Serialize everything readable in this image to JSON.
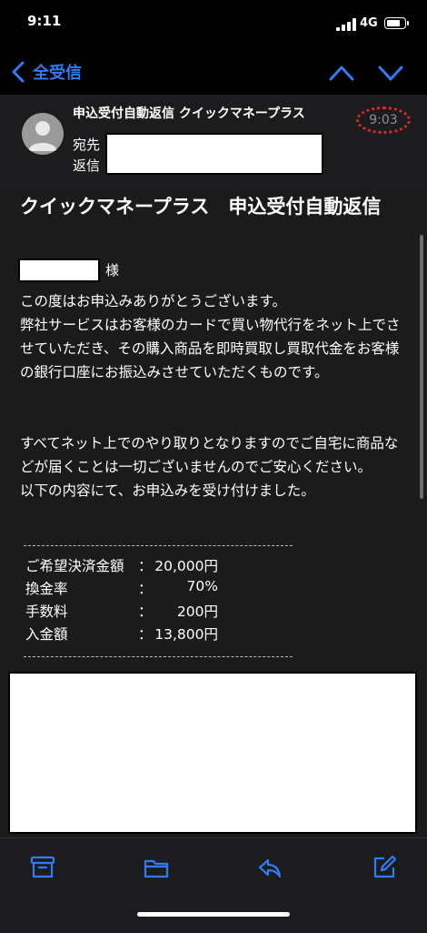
{
  "status_bar": {
    "time": "9:11",
    "network": "4G"
  },
  "nav": {
    "back_label": "全受信"
  },
  "header": {
    "sender": "申込受付自動返信 クイックマネープラス",
    "time": "9:03",
    "to_label": "宛先",
    "reply_label": "返信"
  },
  "message": {
    "title": "クイックマネープラス　申込受付自動返信",
    "honorific": "様",
    "paragraph1": "この度はお申込みありがとうございます。\n弊社サービスはお客様のカードで買い物代行をネット上でさせていただき、その購入商品を即時買取し買取代金をお客様の銀行口座にお振込みさせていただくものです。",
    "paragraph2": "すべてネット上でのやり取りとなりますのでご自宅に商品などが届くことは一切ございませんのでご安心ください。\n以下の内容にて、お申込みを受け付けました。",
    "divider": "----------------------------------------------------",
    "rows": [
      {
        "label": "ご希望決済金額",
        "colon": "：",
        "value": "20,000円"
      },
      {
        "label": "換金率",
        "colon": "：",
        "value": "70%"
      },
      {
        "label": "手数料",
        "colon": "：",
        "value": "200円"
      },
      {
        "label": "入金額",
        "colon": "：",
        "value": "13,800円"
      }
    ]
  },
  "toolbar_icons": [
    "archive-icon",
    "folder-icon",
    "reply-icon",
    "compose-icon"
  ],
  "colors": {
    "accent": "#2f7cf6",
    "background": "#1a1a1a",
    "highlight_circle": "#d12b2b"
  }
}
